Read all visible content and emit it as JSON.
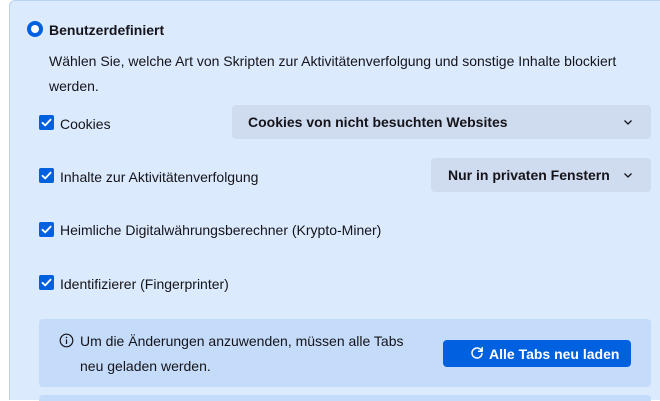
{
  "custom_option": {
    "label": "Benutzerdefiniert",
    "description": "Wählen Sie, welche Art von Skripten zur Aktivitätenverfolgung und sonstige Inhalte blockiert werden."
  },
  "options": [
    {
      "label": "Cookies",
      "checked": true,
      "select": "Cookies von nicht besuchten Websites"
    },
    {
      "label": "Inhalte zur Aktivitätenverfolgung",
      "checked": true,
      "select": "Nur in privaten Fenstern"
    },
    {
      "label": "Heimliche Digitalwährungsberechner (Krypto-Miner)",
      "checked": true
    },
    {
      "label": "Identifizierer (Fingerprinter)",
      "checked": true
    }
  ],
  "notice": {
    "text": "Um die Änderungen anzuwenden, müssen alle Tabs neu geladen werden.",
    "button_label": "Alle Tabs neu laden"
  },
  "colors": {
    "accent": "#0061e0",
    "panel_bg": "#dbeafd",
    "notice_bg": "#c4dcf9"
  },
  "icons": [
    "radio-selected-icon",
    "checkbox-checked-icon",
    "chevron-down-icon",
    "info-icon",
    "reload-icon"
  ]
}
